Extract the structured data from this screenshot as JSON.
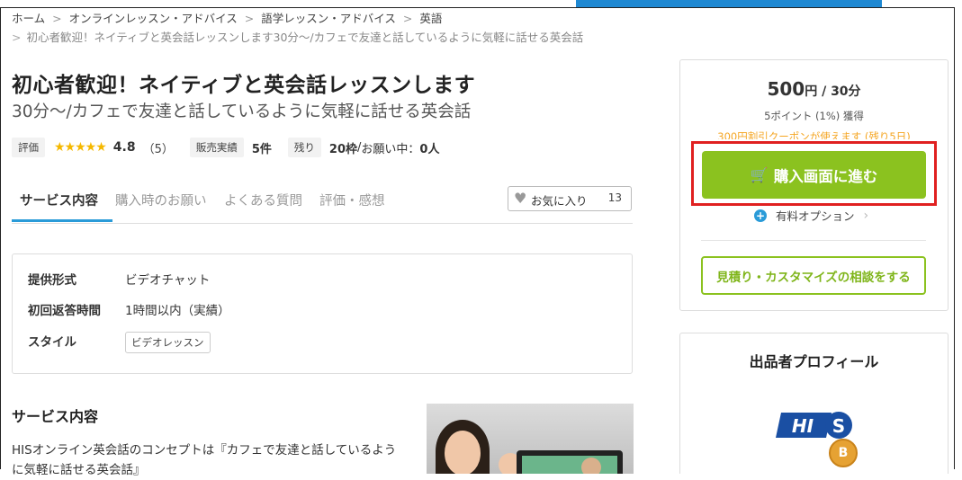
{
  "breadcrumb": {
    "items": [
      "ホーム",
      "オンラインレッスン・アドバイス",
      "語学レッスン・アドバイス",
      "英語"
    ],
    "current": "初心者歓迎！ネイティブと英会話レッスンします30分〜/カフェで友達と話しているように気軽に話せる英会話",
    "separator": ">"
  },
  "service": {
    "title": "初心者歓迎！ネイティブと英会話レッスンします",
    "subtitle": "30分〜/カフェで友達と話しているように気軽に話せる英会話",
    "rating_label": "評価",
    "stars": "★★★★★",
    "rating_value": "4.8",
    "rating_count": "（5）",
    "sales_label": "販売実績",
    "sales_value": "5件",
    "remaining_label": "残り",
    "remaining_slots": "20枠",
    "remaining_sep": " / ",
    "remaining_pending_label": "お願い中：",
    "remaining_pending": "0人"
  },
  "tabs": [
    {
      "label": "サービス内容",
      "active": true
    },
    {
      "label": "購入時のお願い"
    },
    {
      "label": "よくある質問"
    },
    {
      "label": "評価・感想"
    }
  ],
  "favorite": {
    "label": "お気に入り",
    "count": "13",
    "icon": "heart-icon"
  },
  "info": {
    "rows": [
      {
        "label": "提供形式",
        "value": "ビデオチャット"
      },
      {
        "label": "初回返答時間",
        "value": "1時間以内（実績）"
      },
      {
        "label": "スタイル",
        "value": "ビデオレッスン"
      }
    ]
  },
  "content": {
    "section_title": "サービス内容",
    "description": "HISオンライン英会話のコンセプトは『カフェで友達と話しているように気軽に話せる英会話』"
  },
  "purchase": {
    "price": "500",
    "price_unit": "円 / 30分",
    "points": "5ポイント (1%) 獲得",
    "coupon": "300円割引クーポンが使えます (残り5日)",
    "buy_label": "購入画面に進む",
    "option_label": "有料オプション",
    "consult_label": "見積り・カスタマイズの相談をする"
  },
  "profile": {
    "title": "出品者プロフィール",
    "logo_text": "HIS",
    "badge": "B"
  },
  "colors": {
    "accent_green": "#8bc21f",
    "accent_blue": "#2a9bd8",
    "highlight_red": "#e02020",
    "coupon_orange": "#f5a623",
    "star_yellow": "#f5b800"
  }
}
